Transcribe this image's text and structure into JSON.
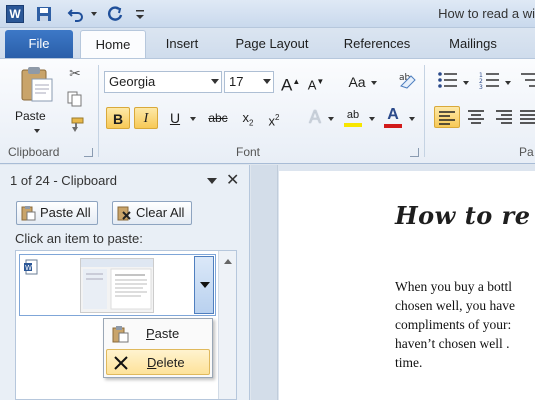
{
  "titlebar": {
    "app_icon_letter": "W",
    "title": "How to read a wi",
    "qat": {
      "save_icon": "save-icon",
      "undo_icon": "undo-icon",
      "redo_icon": "redo-icon",
      "customize_icon": "customize-qat-icon"
    }
  },
  "tabs": {
    "file": "File",
    "items": [
      {
        "label": "Home",
        "active": true
      },
      {
        "label": "Insert",
        "active": false
      },
      {
        "label": "Page Layout",
        "active": false
      },
      {
        "label": "References",
        "active": false
      },
      {
        "label": "Mailings",
        "active": false
      }
    ]
  },
  "ribbon": {
    "clipboard": {
      "paste_label": "Paste",
      "group_label": "Clipboard"
    },
    "font": {
      "font_name": "Georgia",
      "font_size": "17",
      "grow_label": "A",
      "shrink_label": "A",
      "case_label": "Aa",
      "bold": "B",
      "italic": "I",
      "underline": "U",
      "strike": "abc",
      "subscript": "x",
      "superscript": "x",
      "effects": "A",
      "highlight": "ab",
      "font_color": "A",
      "group_label": "Font"
    },
    "paragraph": {
      "group_label": "Pa"
    },
    "colors": {
      "highlight_color": "#f7e600",
      "font_color": "#d11a1a",
      "accent": "#2a5fa9"
    }
  },
  "clipboard_pane": {
    "title": "1 of 24 - Clipboard",
    "paste_all": "Paste All",
    "clear_all": "Clear All",
    "hint": "Click an item to paste:"
  },
  "context_menu": {
    "items": [
      {
        "label": "Paste",
        "icon": "paste-icon"
      },
      {
        "label": "Delete",
        "icon": "delete-icon",
        "hover": true
      }
    ]
  },
  "document": {
    "heading": "How to re",
    "lines": [
      "When you buy a bottl",
      "chosen well,  you have",
      "compliments  of  your:",
      "haven’t chosen well .",
      "time."
    ]
  }
}
